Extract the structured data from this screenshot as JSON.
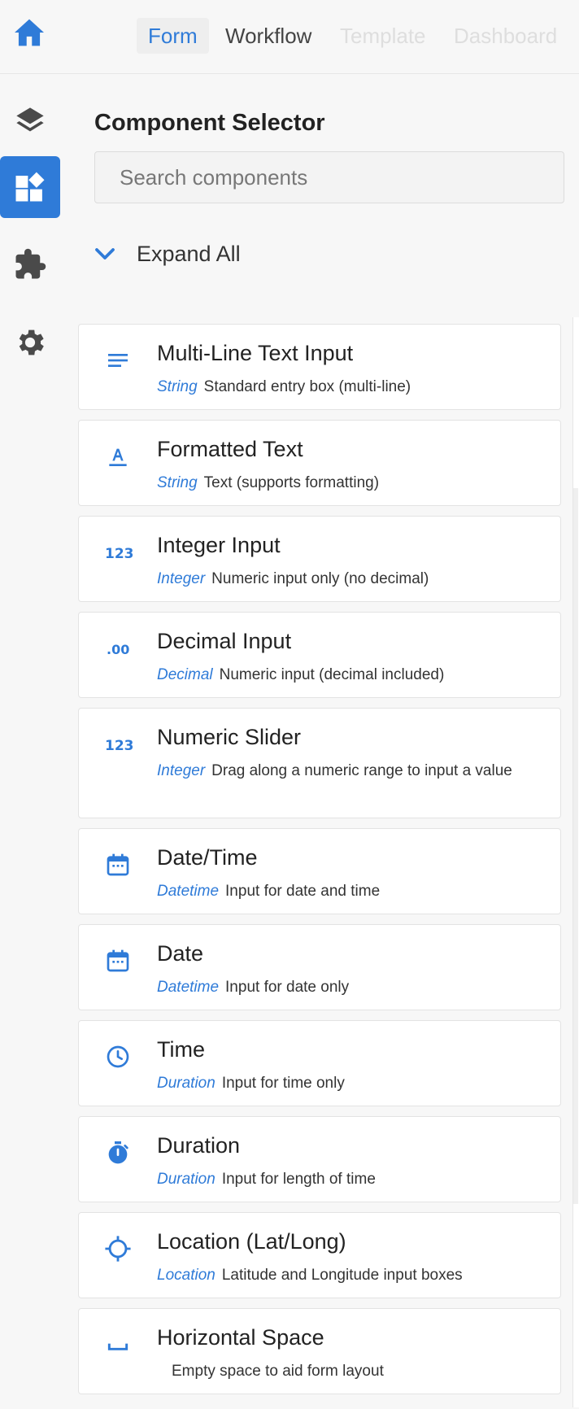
{
  "header": {
    "tabs": [
      {
        "label": "Form",
        "active": true
      },
      {
        "label": "Workflow"
      },
      {
        "label": "Template"
      },
      {
        "label": "Dashboard"
      }
    ]
  },
  "colors": {
    "accent": "#2f7bd8",
    "rail_icon": "#4a4a4a"
  },
  "rail": {
    "items": [
      {
        "icon": "layers-icon"
      },
      {
        "icon": "widgets-icon",
        "active": true
      },
      {
        "icon": "puzzle-icon"
      },
      {
        "icon": "gear-icon"
      }
    ]
  },
  "panel": {
    "title": "Component Selector",
    "search_placeholder": "Search components",
    "expand_all_label": "Expand All"
  },
  "components": [
    {
      "name": "Multi-Line Text Input",
      "type": "String",
      "desc": "Standard entry box (multi-line)",
      "icon": "lines-icon"
    },
    {
      "name": "Formatted Text",
      "type": "String",
      "desc": "Text (supports formatting)",
      "icon": "format-text-icon"
    },
    {
      "name": "Integer Input",
      "type": "Integer",
      "desc": "Numeric input only (no decimal)",
      "icon": "number-123-icon"
    },
    {
      "name": "Decimal Input",
      "type": "Decimal",
      "desc": "Numeric input (decimal included)",
      "icon": "decimal-icon"
    },
    {
      "name": "Numeric Slider",
      "type": "Integer",
      "desc": "Drag along a numeric range to input a value",
      "icon": "number-123-icon"
    },
    {
      "name": "Date/Time",
      "type": "Datetime",
      "desc": "Input for date and time",
      "icon": "calendar-icon"
    },
    {
      "name": "Date",
      "type": "Datetime",
      "desc": "Input for date only",
      "icon": "calendar-icon"
    },
    {
      "name": "Time",
      "type": "Duration",
      "desc": "Input for time only",
      "icon": "clock-icon"
    },
    {
      "name": "Duration",
      "type": "Duration",
      "desc": "Input for length of time",
      "icon": "timer-icon"
    },
    {
      "name": "Location (Lat/Long)",
      "type": "Location",
      "desc": "Latitude and Longitude input boxes",
      "icon": "crosshair-icon"
    },
    {
      "name": "Horizontal Space",
      "type": "",
      "desc": "Empty space to aid form layout",
      "icon": "space-icon"
    }
  ]
}
